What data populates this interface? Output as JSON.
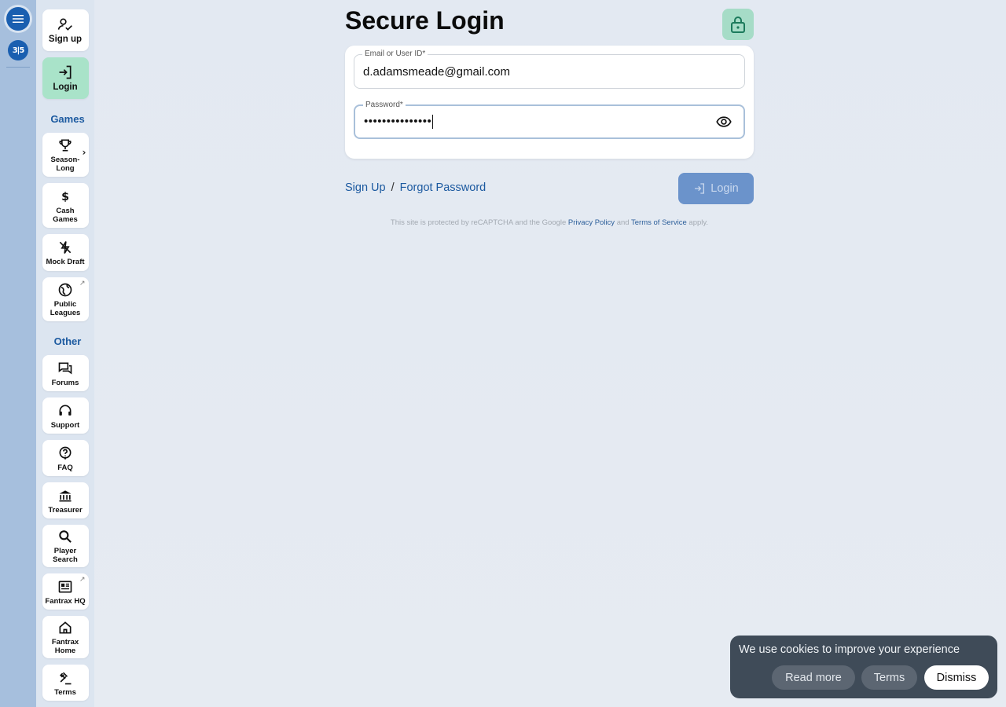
{
  "rail": {
    "menu_icon": "menu-icon",
    "logo_text": "3|5"
  },
  "nav": {
    "top": [
      {
        "label": "Sign up",
        "icon": "person-check-icon"
      },
      {
        "label": "Login",
        "icon": "login-icon"
      }
    ],
    "games_heading": "Games",
    "games": [
      {
        "label": "Season-Long",
        "icon": "trophy-icon"
      },
      {
        "label": "Cash Games",
        "icon": "dollar-icon"
      },
      {
        "label": "Mock Draft",
        "icon": "lightning-off-icon"
      },
      {
        "label": "Public Leagues",
        "icon": "globe-icon"
      }
    ],
    "other_heading": "Other",
    "other": [
      {
        "label": "Forums",
        "icon": "forum-icon"
      },
      {
        "label": "Support",
        "icon": "headset-icon"
      },
      {
        "label": "FAQ",
        "icon": "help-icon"
      },
      {
        "label": "Treasurer",
        "icon": "bank-icon"
      },
      {
        "label": "Player Search",
        "icon": "search-icon"
      },
      {
        "label": "Fantrax HQ",
        "icon": "newspaper-icon"
      },
      {
        "label": "Fantrax Home",
        "icon": "home-icon"
      },
      {
        "label": "Terms",
        "icon": "gavel-icon"
      }
    ]
  },
  "main": {
    "title": "Secure Login",
    "email": {
      "label": "Email or User ID*",
      "value": "d.adamsmeade@gmail.com"
    },
    "password": {
      "label": "Password*",
      "value": "•••••••••••••••"
    },
    "signup_link": "Sign Up",
    "separator": "/",
    "forgot_link": "Forgot Password",
    "login_button": "Login",
    "recaptcha": {
      "prefix": "This site is protected by reCAPTCHA and the Google",
      "privacy": "Privacy Policy",
      "and": "and",
      "terms": "Terms of Service",
      "suffix": "apply."
    }
  },
  "cookie": {
    "message": "We use cookies to improve your experience",
    "read_more": "Read more",
    "terms": "Terms",
    "dismiss": "Dismiss"
  },
  "colors": {
    "accent": "#1c5aa0",
    "active_nav": "#a9e3c9",
    "login_button": "#6b93cb",
    "cookie_bg": "#3f4b58"
  }
}
